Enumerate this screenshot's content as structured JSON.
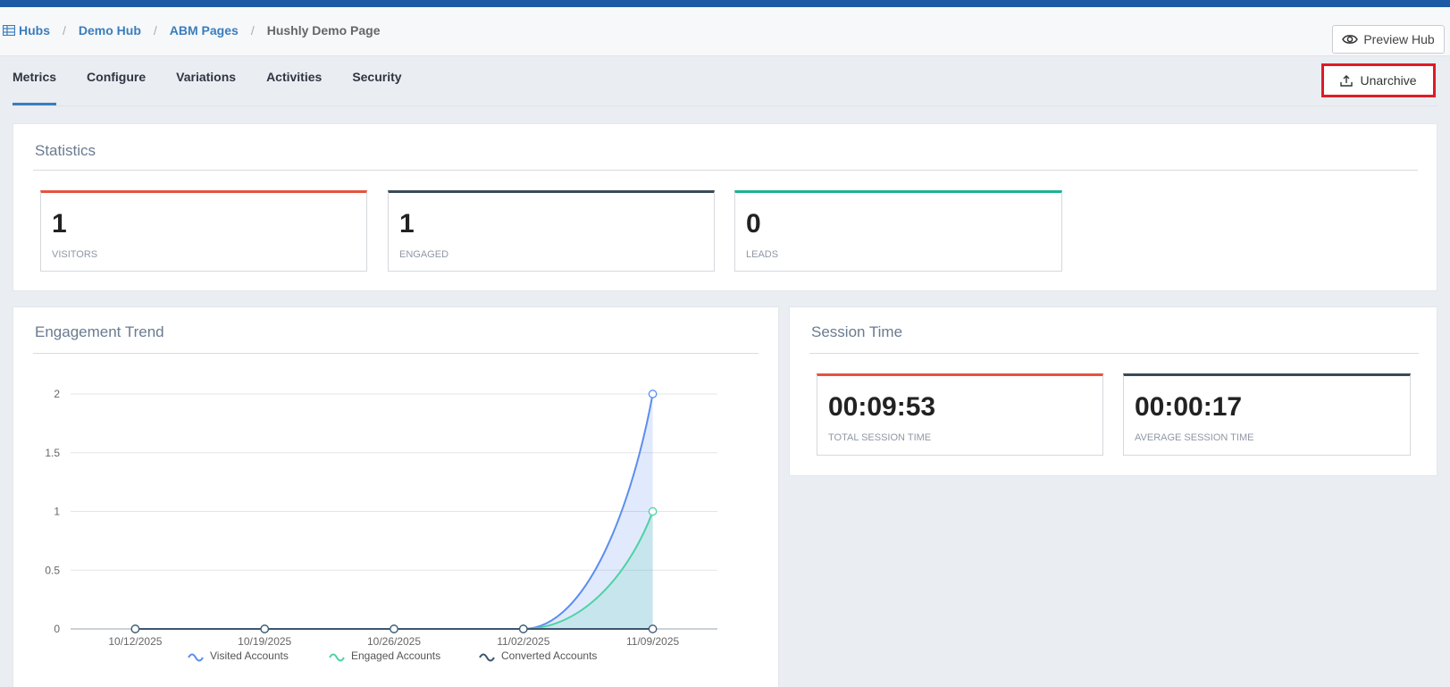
{
  "breadcrumb": {
    "items": [
      "Hubs",
      "Demo Hub",
      "ABM Pages"
    ],
    "current": "Hushly Demo Page",
    "separator": "/"
  },
  "header": {
    "preview_label": "Preview Hub"
  },
  "tabs": [
    {
      "label": "Metrics",
      "active": true
    },
    {
      "label": "Configure"
    },
    {
      "label": "Variations"
    },
    {
      "label": "Activities"
    },
    {
      "label": "Security"
    }
  ],
  "actions": {
    "unarchive_label": "Unarchive"
  },
  "statistics": {
    "title": "Statistics",
    "cards": [
      {
        "value": "1",
        "label": "VISITORS",
        "color": "#e5533d"
      },
      {
        "value": "1",
        "label": "ENGAGED",
        "color": "#3a4a57"
      },
      {
        "value": "0",
        "label": "LEADS",
        "color": "#1ab394"
      }
    ]
  },
  "engagement": {
    "title": "Engagement Trend"
  },
  "session": {
    "title": "Session Time",
    "cards": [
      {
        "value": "00:09:53",
        "label": "TOTAL SESSION TIME",
        "color": "#e5533d"
      },
      {
        "value": "00:00:17",
        "label": "AVERAGE SESSION TIME",
        "color": "#3a4a57"
      }
    ]
  },
  "chart_data": {
    "type": "area",
    "categories": [
      "10/12/2025",
      "10/19/2025",
      "10/26/2025",
      "11/02/2025",
      "11/09/2025"
    ],
    "ylim": [
      0,
      2
    ],
    "yticks": [
      "0",
      "0.5",
      "1",
      "1.5",
      "2"
    ],
    "grid": true,
    "legend": "bottom",
    "series": [
      {
        "name": "Visited Accounts",
        "values": [
          0,
          0,
          0,
          0,
          2
        ],
        "color": "#5b8def"
      },
      {
        "name": "Engaged Accounts",
        "values": [
          0,
          0,
          0,
          0,
          1
        ],
        "color": "#4fd1a5"
      },
      {
        "name": "Converted Accounts",
        "values": [
          0,
          0,
          0,
          0,
          0
        ],
        "color": "#3d5570"
      }
    ]
  }
}
